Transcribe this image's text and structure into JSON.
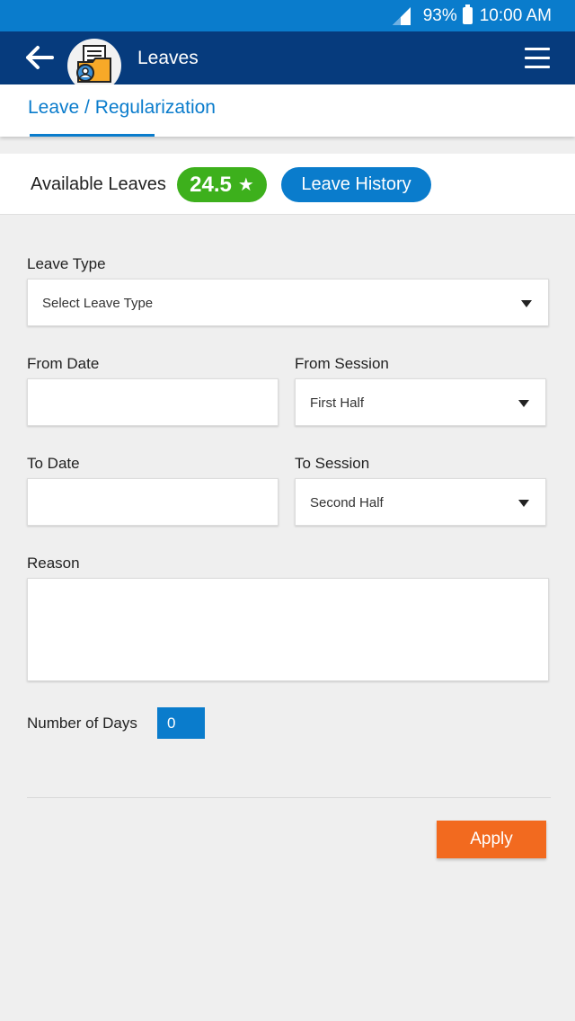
{
  "status_bar": {
    "battery": "93%",
    "time": "10:00 AM"
  },
  "app_bar": {
    "title": "Leaves"
  },
  "tabs": [
    {
      "label": "Leave / Regularization",
      "active": true
    }
  ],
  "summary": {
    "available_label": "Available Leaves",
    "available_value": "24.5",
    "star": "★",
    "history_button": "Leave History"
  },
  "form": {
    "leave_type": {
      "label": "Leave Type",
      "value": "Select Leave Type"
    },
    "from_date": {
      "label": "From Date",
      "value": ""
    },
    "from_session": {
      "label": "From Session",
      "value": "First Half"
    },
    "to_date": {
      "label": "To Date",
      "value": ""
    },
    "to_session": {
      "label": "To Session",
      "value": "Second Half"
    },
    "reason": {
      "label": "Reason",
      "value": ""
    },
    "number_of_days": {
      "label": "Number of Days",
      "value": "0"
    }
  },
  "apply_button": "Apply",
  "colors": {
    "status_bar": "#0a7ccc",
    "app_bar": "#063b7d",
    "accent": "#0a7ccc",
    "badge_green": "#3db01c",
    "apply_orange": "#f26a1f"
  },
  "icons": [
    "signal-icon",
    "battery-icon",
    "back-arrow-icon",
    "leaves-folder-icon",
    "menu-icon",
    "star-icon",
    "dropdown-caret-icon"
  ]
}
